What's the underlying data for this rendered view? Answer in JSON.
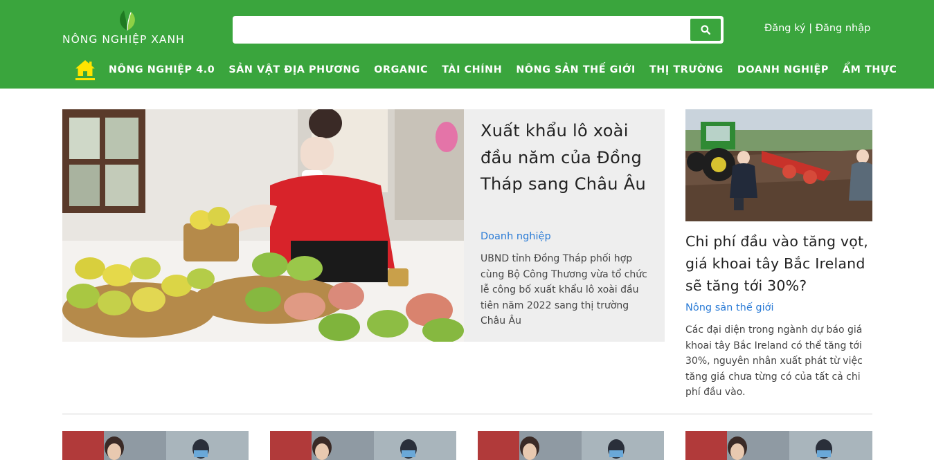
{
  "header": {
    "logo_text": "NÔNG NGHIỆP XANH",
    "search": {
      "value": "",
      "placeholder": ""
    },
    "auth": {
      "register": "Đăng ký",
      "separator": " | ",
      "login": "Đăng nhập"
    },
    "colors": {
      "brand": "#3aa53d",
      "home_underline": "#ffe400"
    }
  },
  "nav": {
    "home_icon": "home-icon",
    "items": [
      "NÔNG NGHIỆP 4.0",
      "SẢN VẬT ĐỊA PHƯƠNG",
      "ORGANIC",
      "TÀI CHÍNH",
      "NÔNG SẢN THẾ GIỚI",
      "THỊ TRƯỜNG",
      "DOANH NGHIỆP",
      "ẨM THỰC"
    ]
  },
  "featured": {
    "title": "Xuất khẩu lô xoài đầu năm của Đồng Tháp sang Châu Âu",
    "category": "Doanh nghiệp",
    "description": "UBND tỉnh Đồng Tháp phối hợp cùng Bộ Công Thương vừa tổ chức lễ công bố xuất khẩu lô xoài đầu tiên năm 2022 sang thị trường Châu Âu"
  },
  "side_article": {
    "title": "Chi phí đầu vào tăng vọt, giá khoai tây Bắc Ireland sẽ tăng tới 30%?",
    "category": "Nông sản thế giới",
    "description": "Các đại diện trong ngành dự báo giá khoai tây Bắc Ireland có thể tăng tới 30%, nguyên nhân xuất phát từ việc tăng giá chưa từng có của tất cả chi phí đầu vào."
  },
  "category_color": "#2a7bd6"
}
